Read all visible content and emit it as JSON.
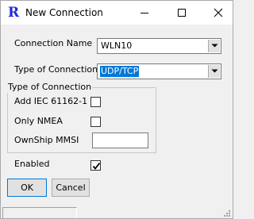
{
  "window": {
    "title": "New Connection",
    "app_icon": "R",
    "app_icon_color": "#1c2bd8"
  },
  "title_buttons": {
    "minimize": "minimize-icon",
    "maximize": "maximize-icon",
    "close": "close-icon"
  },
  "form": {
    "connection_name_label": "Connection Name",
    "connection_name_value": "WLN10",
    "type_label": "Type of Connection",
    "type_value": "UDP/TCP"
  },
  "group": {
    "legend": "Type of Connection",
    "add_iec_label": "Add IEC 61162-1",
    "add_iec_checked": false,
    "only_nmea_label": "Only NMEA",
    "only_nmea_checked": false,
    "ownship_mmsi_label": "OwnShip MMSI",
    "ownship_mmsi_value": ""
  },
  "enabled": {
    "label": "Enabled",
    "checked": true
  },
  "buttons": {
    "ok": "OK",
    "cancel": "Cancel"
  },
  "colors": {
    "selection": "#0078d7",
    "background": "#f0f0f0"
  }
}
